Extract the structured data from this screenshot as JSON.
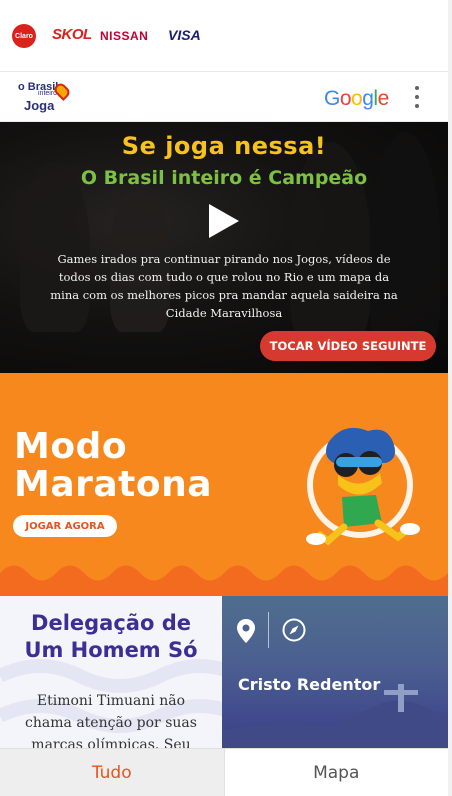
{
  "sponsors": {
    "claro": "Claro",
    "skol": "SKOL",
    "nissan": "NISSAN",
    "visa": "VISA"
  },
  "header": {
    "logo_line1": "o Brasil",
    "logo_line2": "inteiro",
    "logo_line3": "Joga",
    "google_letters": [
      "G",
      "o",
      "o",
      "g",
      "l",
      "e"
    ],
    "google_colors": [
      "#4285F4",
      "#EA4335",
      "#FBBC05",
      "#4285F4",
      "#34A853",
      "#EA4335"
    ],
    "menu_icon": "more-vert-icon"
  },
  "hero": {
    "title": "Se joga nessa!",
    "subtitle": "O Brasil inteiro é Campeão",
    "description": "Games irados pra continuar pirando nos Jogos, vídeos de todos os dias com tudo o que rolou no Rio e um mapa da mina com os melhores picos pra mandar aquela saideira na Cidade Maravilhosa",
    "next_button": "TOCAR VÍDEO SEGUINTE",
    "title_color": "#f7c21a",
    "subtitle_color": "#7cc242",
    "button_color": "#d63a2f"
  },
  "maratona": {
    "title_line1": "Modo",
    "title_line2": "Maratona",
    "cta": "JOGAR AGORA",
    "background": "#f7881d"
  },
  "cards": {
    "left": {
      "title_line1": "Delegação de",
      "title_line2": "Um Homem Só",
      "text": "Etimoni Timuani não chama atenção por suas marcas olímpicas. Seu"
    },
    "right": {
      "name": "Cristo Redentor",
      "icons": [
        "map-pin-icon",
        "compass-icon"
      ]
    }
  },
  "tabs": {
    "all": "Tudo",
    "map": "Mapa",
    "active_color": "#e8541e"
  }
}
